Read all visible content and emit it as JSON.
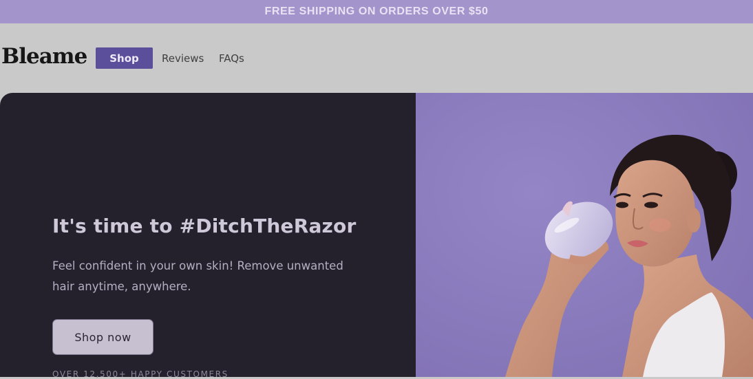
{
  "announcement": {
    "text": "FREE SHIPPING ON ORDERS OVER $50"
  },
  "header": {
    "logo": "Bleame",
    "nav": {
      "shop": "Shop",
      "reviews": "Reviews",
      "faqs": "FAQs"
    }
  },
  "hero": {
    "headline": "It's time to #DitchTheRazor",
    "subcopy": "Feel confident in your own skin! Remove unwanted hair anytime, anywhere.",
    "cta": "Shop now",
    "social_proof": "OVER 12,500+ HAPPY CUSTOMERS",
    "image_subject": "woman-holding-crystal-hair-eraser"
  },
  "colors": {
    "announcement_bg": "#a494cc",
    "nav_active_bg": "#5b4e9b",
    "hero_dark_bg": "#24212c",
    "hero_image_bg": "#8b7cbd"
  }
}
